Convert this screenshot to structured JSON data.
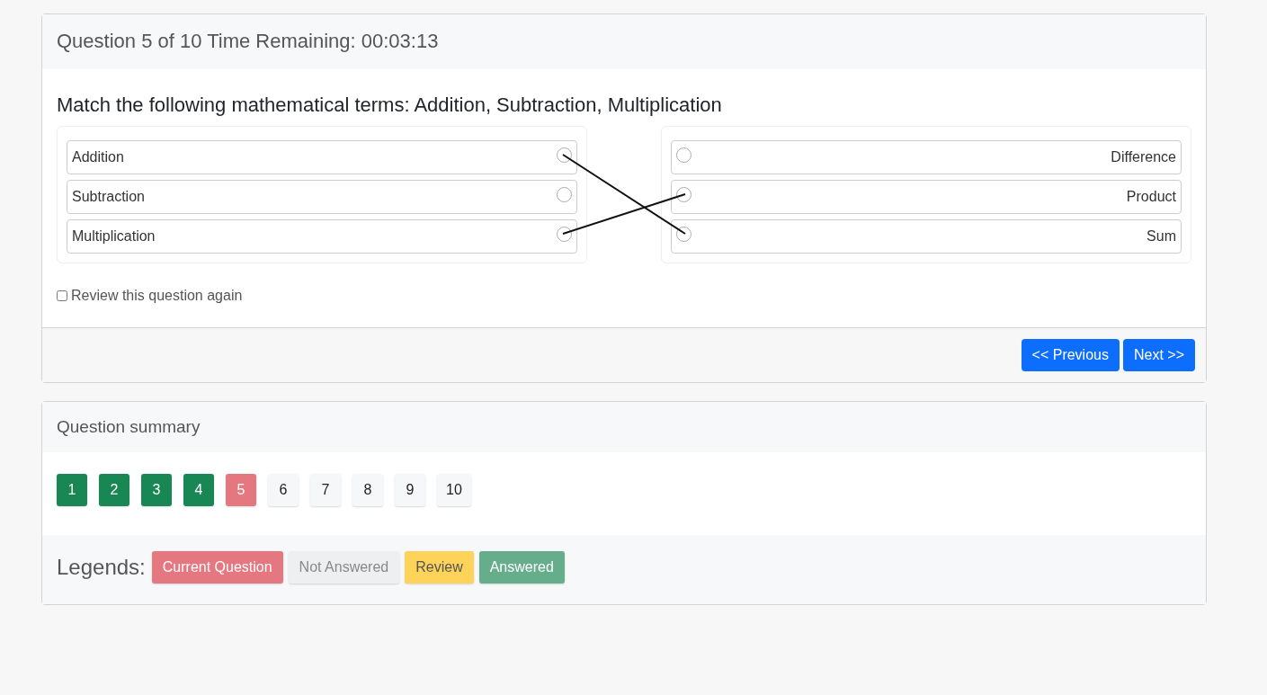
{
  "question_card": {
    "header": "Question 5 of 10 Time Remaining: 00:03:13",
    "prompt": "Match the following mathematical terms: Addition, Subtraction, Multiplication",
    "left_items": [
      {
        "label": "Addition",
        "kind": "linked_third"
      },
      {
        "label": "Subtraction",
        "kind": "unlinked"
      },
      {
        "label": "Multiplication",
        "kind": "linked_second"
      }
    ],
    "right_items": [
      "Difference",
      "Product",
      "Sum"
    ],
    "review": {
      "label": "Review this question again",
      "checked": false
    },
    "buttons": [
      "<< Previous",
      "Next >>"
    ]
  },
  "summary_card": {
    "header": "Question summary",
    "questions": [
      {
        "label": "1",
        "kind": "answered"
      },
      {
        "label": "2",
        "kind": "answered"
      },
      {
        "label": "3",
        "kind": "answered"
      },
      {
        "label": "4",
        "kind": "answered"
      },
      {
        "label": "5",
        "kind": "current"
      },
      {
        "label": "6",
        "kind": "not_answered"
      },
      {
        "label": "7",
        "kind": "not_answered"
      },
      {
        "label": "8",
        "kind": "not_answered"
      },
      {
        "label": "9",
        "kind": "not_answered"
      },
      {
        "label": "10",
        "kind": "not_answered"
      }
    ],
    "legend_title": "Legends:",
    "legends": [
      {
        "label": "Current Question",
        "kind": "current"
      },
      {
        "label": "Not Answered",
        "kind": "not_answered"
      },
      {
        "label": "Review",
        "kind": "review"
      },
      {
        "label": "Answered",
        "kind": "answered"
      }
    ]
  }
}
